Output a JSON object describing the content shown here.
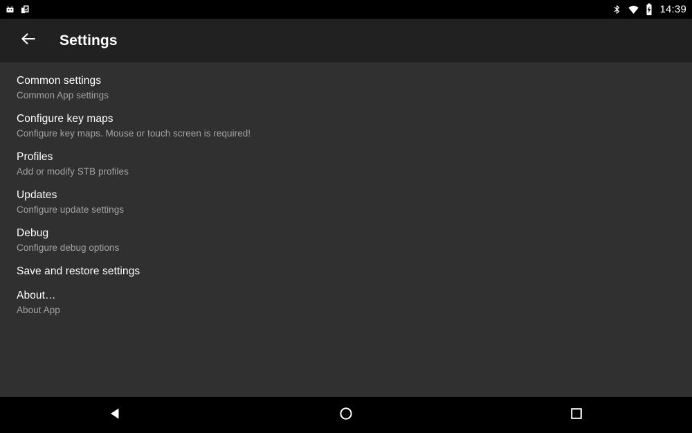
{
  "status_bar": {
    "notification_icons": [
      "robot-notification-icon",
      "clipboard-check-notification-icon"
    ],
    "system_icons": [
      "bluetooth-icon",
      "wifi-icon",
      "battery-charging-icon"
    ],
    "time": "14:39",
    "background_color": "#000000"
  },
  "app_bar": {
    "back_icon": "back-arrow-icon",
    "title": "Settings",
    "background_color": "#212121"
  },
  "content": {
    "background_color": "#303030",
    "items": [
      {
        "title": "Common settings",
        "summary": "Common App settings"
      },
      {
        "title": "Configure key maps",
        "summary": "Configure key maps. Mouse or touch screen is required!"
      },
      {
        "title": "Profiles",
        "summary": "Add or modify STB profiles"
      },
      {
        "title": "Updates",
        "summary": "Configure update settings"
      },
      {
        "title": "Debug",
        "summary": "Configure debug options"
      },
      {
        "title": "Save and restore settings",
        "summary": ""
      },
      {
        "title": "About…",
        "summary": "About App"
      }
    ]
  },
  "nav_bar": {
    "background_color": "#000000",
    "buttons": [
      {
        "name": "back-nav-icon"
      },
      {
        "name": "home-nav-icon"
      },
      {
        "name": "recents-nav-icon"
      }
    ]
  }
}
